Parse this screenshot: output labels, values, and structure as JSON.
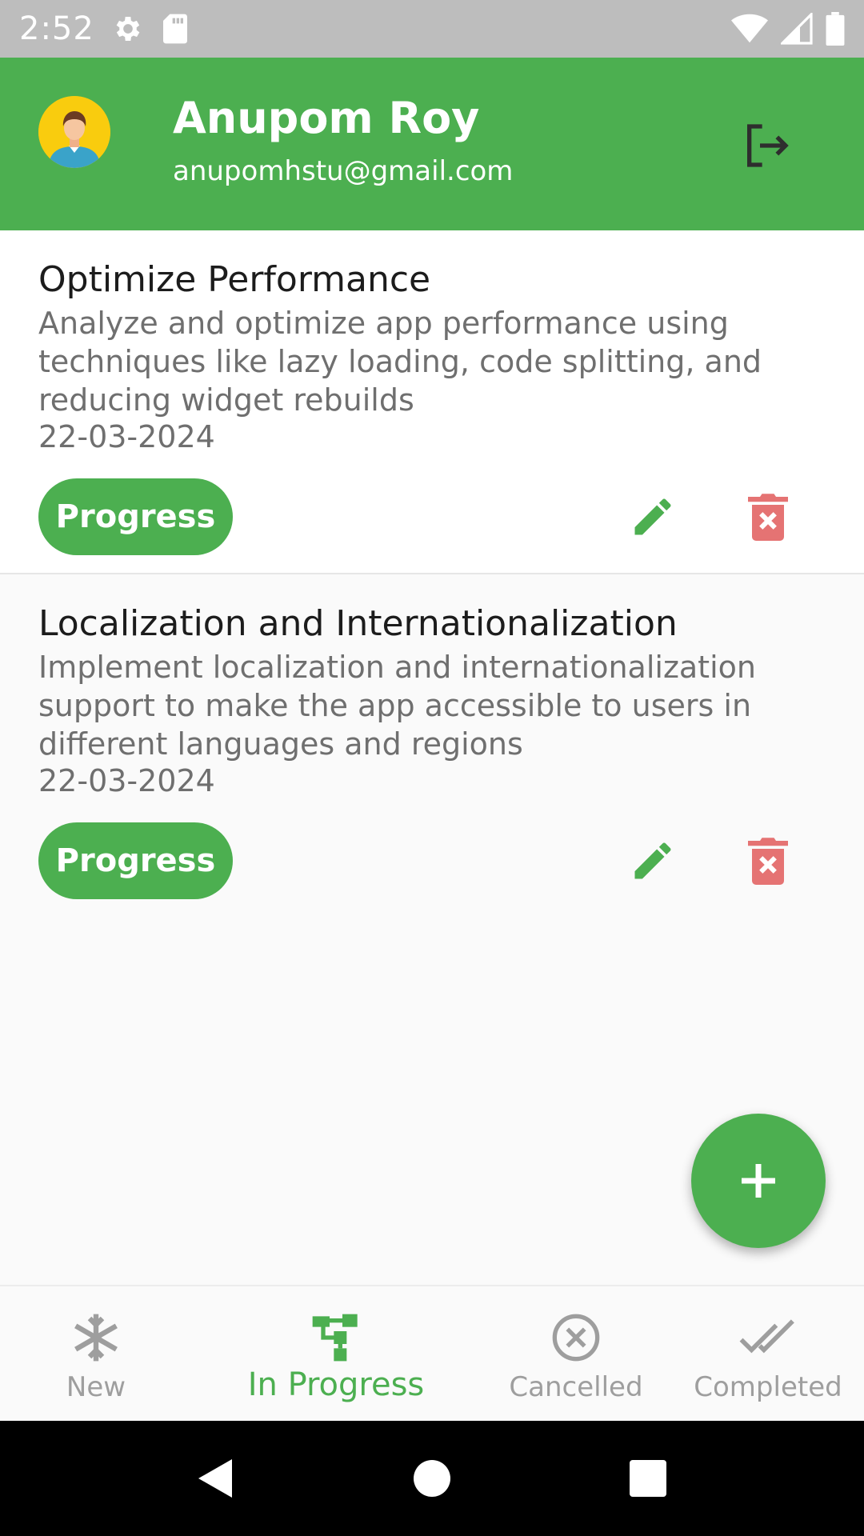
{
  "status_bar": {
    "time": "2:52",
    "left_icons": [
      "gear-icon",
      "sd-card-icon"
    ],
    "right_icons": [
      "wifi-icon",
      "signal-icon",
      "battery-icon"
    ]
  },
  "header": {
    "name": "Anupom Roy",
    "email": "anupomhstu@gmail.com",
    "avatar_icon": "user-avatar-icon",
    "logout_icon": "logout-icon",
    "color": "#4caf50"
  },
  "tasks": [
    {
      "title": "Optimize Performance",
      "description": "Analyze and optimize app performance using techniques like lazy loading, code splitting, and reducing widget rebuilds",
      "date": "22-03-2024",
      "status": "Progress"
    },
    {
      "title": "Localization and Internationalization",
      "description": "Implement localization and internationalization support to make the app accessible to users in different languages and regions",
      "date": "22-03-2024",
      "status": "Progress"
    }
  ],
  "fab": {
    "icon": "plus-icon"
  },
  "bottom_nav": {
    "items": [
      {
        "label": "New",
        "icon": "snowflake-icon",
        "active": false
      },
      {
        "label": "In Progress",
        "icon": "tree-icon",
        "active": true
      },
      {
        "label": "Cancelled",
        "icon": "cancel-circle-icon",
        "active": false
      },
      {
        "label": "Completed",
        "icon": "double-check-icon",
        "active": false
      }
    ]
  },
  "colors": {
    "accent": "#4caf50",
    "delete": "#e57373",
    "muted": "#9e9e9e"
  }
}
